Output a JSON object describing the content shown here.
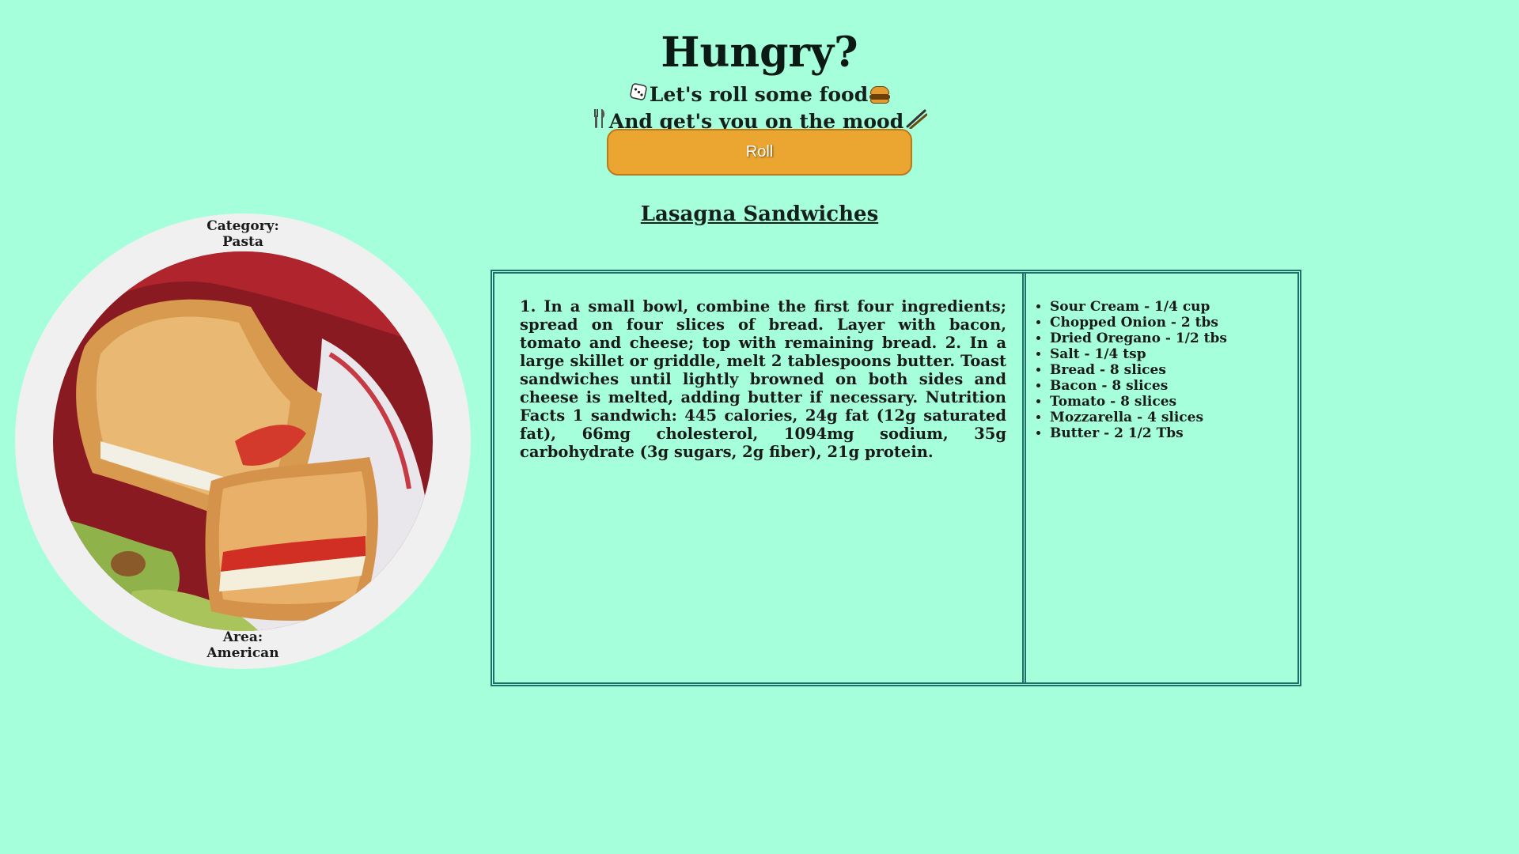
{
  "header": {
    "title": "Hungry?",
    "line1": "Let's roll some food",
    "line2": "And get's you on the mood",
    "dice_icon": "dice-icon",
    "burger_icon": "burger-icon",
    "fork_knife_icon": "fork-knife-icon",
    "chopsticks_icon": "chopsticks-icon"
  },
  "roll_button": {
    "label": "Roll"
  },
  "recipe": {
    "name": "Lasagna Sandwiches",
    "category_label": "Category:",
    "category": "Pasta",
    "area_label": "Area:",
    "area": "American",
    "instructions": "1. In a small bowl, combine the first four ingredients; spread on four slices of bread. Layer with bacon, tomato and cheese; top with remaining bread. 2. In a large skillet or griddle, melt 2 tablespoons butter. Toast sandwiches until lightly browned on both sides and cheese is melted, adding butter if necessary. Nutrition Facts 1 sandwich: 445 calories, 24g fat (12g saturated fat), 66mg cholesterol, 1094mg sodium, 35g carbohydrate (3g sugars, 2g fiber), 21g protein.",
    "ingredients": [
      "Sour Cream - 1/4 cup",
      "Chopped Onion - 2 tbs",
      "Dried Oregano - 1/2 tbs",
      "Salt - 1/4 tsp",
      "Bread - 8 slices",
      "Bacon - 8 slices",
      "Tomato - 8 slices",
      "Mozzarella - 4 slices",
      "Butter - 2 1/2 Tbs"
    ]
  },
  "colors": {
    "background": "#a5ffdb",
    "button": "#eba631",
    "border": "#1f6f6a",
    "circle": "#f0f0f0"
  }
}
